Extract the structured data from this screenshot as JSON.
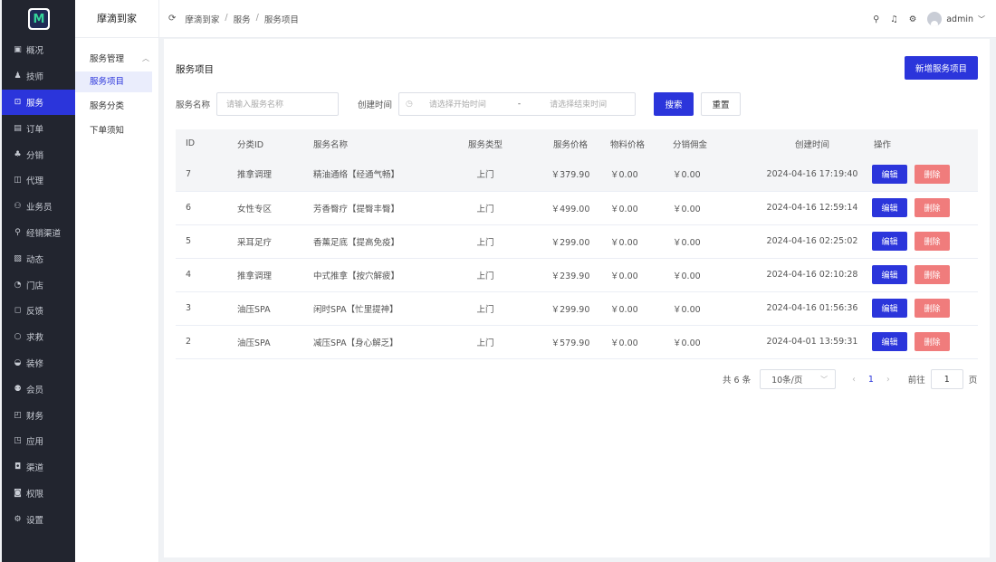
{
  "app": {
    "logo_letter": "M",
    "name": "摩滴到家"
  },
  "sidebar": {
    "items": [
      {
        "label": "概况",
        "icon": "dashboard-icon",
        "glyph": "▣"
      },
      {
        "label": "技师",
        "icon": "technician-icon",
        "glyph": "♟"
      },
      {
        "label": "服务",
        "icon": "service-icon",
        "glyph": "⊡",
        "active": true
      },
      {
        "label": "订单",
        "icon": "order-icon",
        "glyph": "▤"
      },
      {
        "label": "分销",
        "icon": "distribution-icon",
        "glyph": "♣"
      },
      {
        "label": "代理",
        "icon": "agent-icon",
        "glyph": "◫"
      },
      {
        "label": "业务员",
        "icon": "salesman-icon",
        "glyph": "⚇"
      },
      {
        "label": "经销渠道",
        "icon": "channel-tree-icon",
        "glyph": "⚲"
      },
      {
        "label": "动态",
        "icon": "feed-icon",
        "glyph": "▧"
      },
      {
        "label": "门店",
        "icon": "store-icon",
        "glyph": "◔"
      },
      {
        "label": "反馈",
        "icon": "feedback-icon",
        "glyph": "◻"
      },
      {
        "label": "求救",
        "icon": "sos-icon",
        "glyph": "○"
      },
      {
        "label": "装修",
        "icon": "decoration-icon",
        "glyph": "◒"
      },
      {
        "label": "会员",
        "icon": "member-icon",
        "glyph": "⚉"
      },
      {
        "label": "财务",
        "icon": "finance-icon",
        "glyph": "◰"
      },
      {
        "label": "应用",
        "icon": "app-icon",
        "glyph": "◳"
      },
      {
        "label": "渠道",
        "icon": "channel-icon",
        "glyph": "◘"
      },
      {
        "label": "权限",
        "icon": "lock-icon",
        "glyph": "◙"
      },
      {
        "label": "设置",
        "icon": "gear-icon",
        "glyph": "⚙"
      }
    ]
  },
  "subnav": {
    "title": "摩滴到家",
    "group": "服务管理",
    "items": [
      {
        "label": "服务项目",
        "active": true
      },
      {
        "label": "服务分类"
      },
      {
        "label": "下单须知"
      }
    ]
  },
  "breadcrumb": [
    "摩滴到家",
    "服务",
    "服务项目"
  ],
  "topbar": {
    "username": "admin"
  },
  "page": {
    "title": "服务项目",
    "add_button": "新增服务项目"
  },
  "filter": {
    "name_label": "服务名称",
    "name_placeholder": "请输入服务名称",
    "time_label": "创建时间",
    "start_placeholder": "请选择开始时间",
    "range_sep": "-",
    "end_placeholder": "请选择结束时间",
    "search": "搜索",
    "reset": "重置"
  },
  "table": {
    "headers": [
      "ID",
      "分类ID",
      "服务名称",
      "服务类型",
      "服务价格",
      "物料价格",
      "分销佣金",
      "创建时间",
      "操作"
    ],
    "rows": [
      {
        "id": "7",
        "cat": "推拿调理",
        "name": "精油通络【经通气畅】",
        "type": "上门",
        "price": "￥379.90",
        "material": "￥0.00",
        "commission": "￥0.00",
        "created": "2024-04-16 17:19:40"
      },
      {
        "id": "6",
        "cat": "女性专区",
        "name": "芳香臀疗【提臀丰臀】",
        "type": "上门",
        "price": "￥499.00",
        "material": "￥0.00",
        "commission": "￥0.00",
        "created": "2024-04-16 12:59:14"
      },
      {
        "id": "5",
        "cat": "采耳足疗",
        "name": "香薰足底【提高免疫】",
        "type": "上门",
        "price": "￥299.00",
        "material": "￥0.00",
        "commission": "￥0.00",
        "created": "2024-04-16 02:25:02"
      },
      {
        "id": "4",
        "cat": "推拿调理",
        "name": "中式推拿【按穴解疲】",
        "type": "上门",
        "price": "￥239.90",
        "material": "￥0.00",
        "commission": "￥0.00",
        "created": "2024-04-16 02:10:28"
      },
      {
        "id": "3",
        "cat": "油压SPA",
        "name": "闲时SPA【忙里提神】",
        "type": "上门",
        "price": "￥299.90",
        "material": "￥0.00",
        "commission": "￥0.00",
        "created": "2024-04-16 01:56:36"
      },
      {
        "id": "2",
        "cat": "油压SPA",
        "name": "减压SPA【身心解乏】",
        "type": "上门",
        "price": "￥579.90",
        "material": "￥0.00",
        "commission": "￥0.00",
        "created": "2024-04-01 13:59:31"
      }
    ],
    "edit_label": "编辑",
    "delete_label": "删除"
  },
  "pagination": {
    "total": "共 6 条",
    "page_size": "10条/页",
    "current": "1",
    "goto_label": "前往",
    "goto_value": "1",
    "page_suffix": "页"
  },
  "colors": {
    "primary": "#2b35db",
    "danger": "#f07c7c",
    "sidebar": "#22252f"
  }
}
